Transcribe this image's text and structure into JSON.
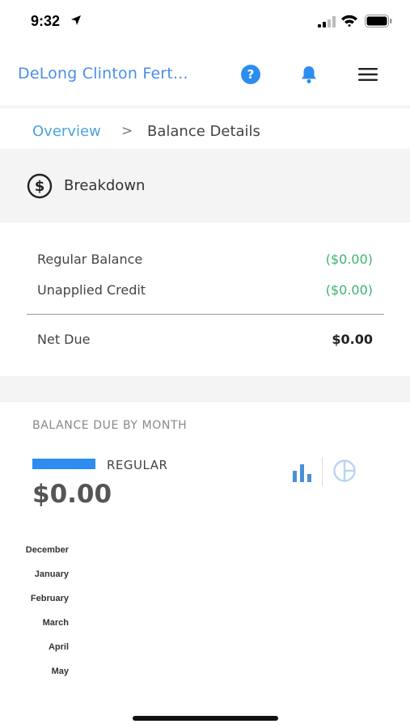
{
  "status": {
    "time": "9:32"
  },
  "appbar": {
    "title": "DeLong Clinton Fert...",
    "help_label": "?"
  },
  "breadcrumb": {
    "parent": "Overview",
    "separator": ">",
    "current": "Balance Details"
  },
  "breakdown": {
    "title": "Breakdown",
    "rows": [
      {
        "label": "Regular Balance",
        "value": "($0.00)"
      },
      {
        "label": "Unapplied Credit",
        "value": "($0.00)"
      }
    ],
    "net": {
      "label": "Net Due",
      "value": "$0.00"
    }
  },
  "colors": {
    "accent": "#2d8cf0",
    "link": "#4aa3df",
    "credit": "#3cb371"
  },
  "chart_data": {
    "type": "bar",
    "orientation": "horizontal",
    "title": "BALANCE DUE BY MONTH",
    "legend": [
      "REGULAR"
    ],
    "total": "$0.00",
    "categories": [
      "December",
      "January",
      "February",
      "March",
      "April",
      "May"
    ],
    "series": [
      {
        "name": "REGULAR",
        "values": [
          0,
          0,
          0,
          0,
          0,
          0
        ]
      }
    ]
  }
}
